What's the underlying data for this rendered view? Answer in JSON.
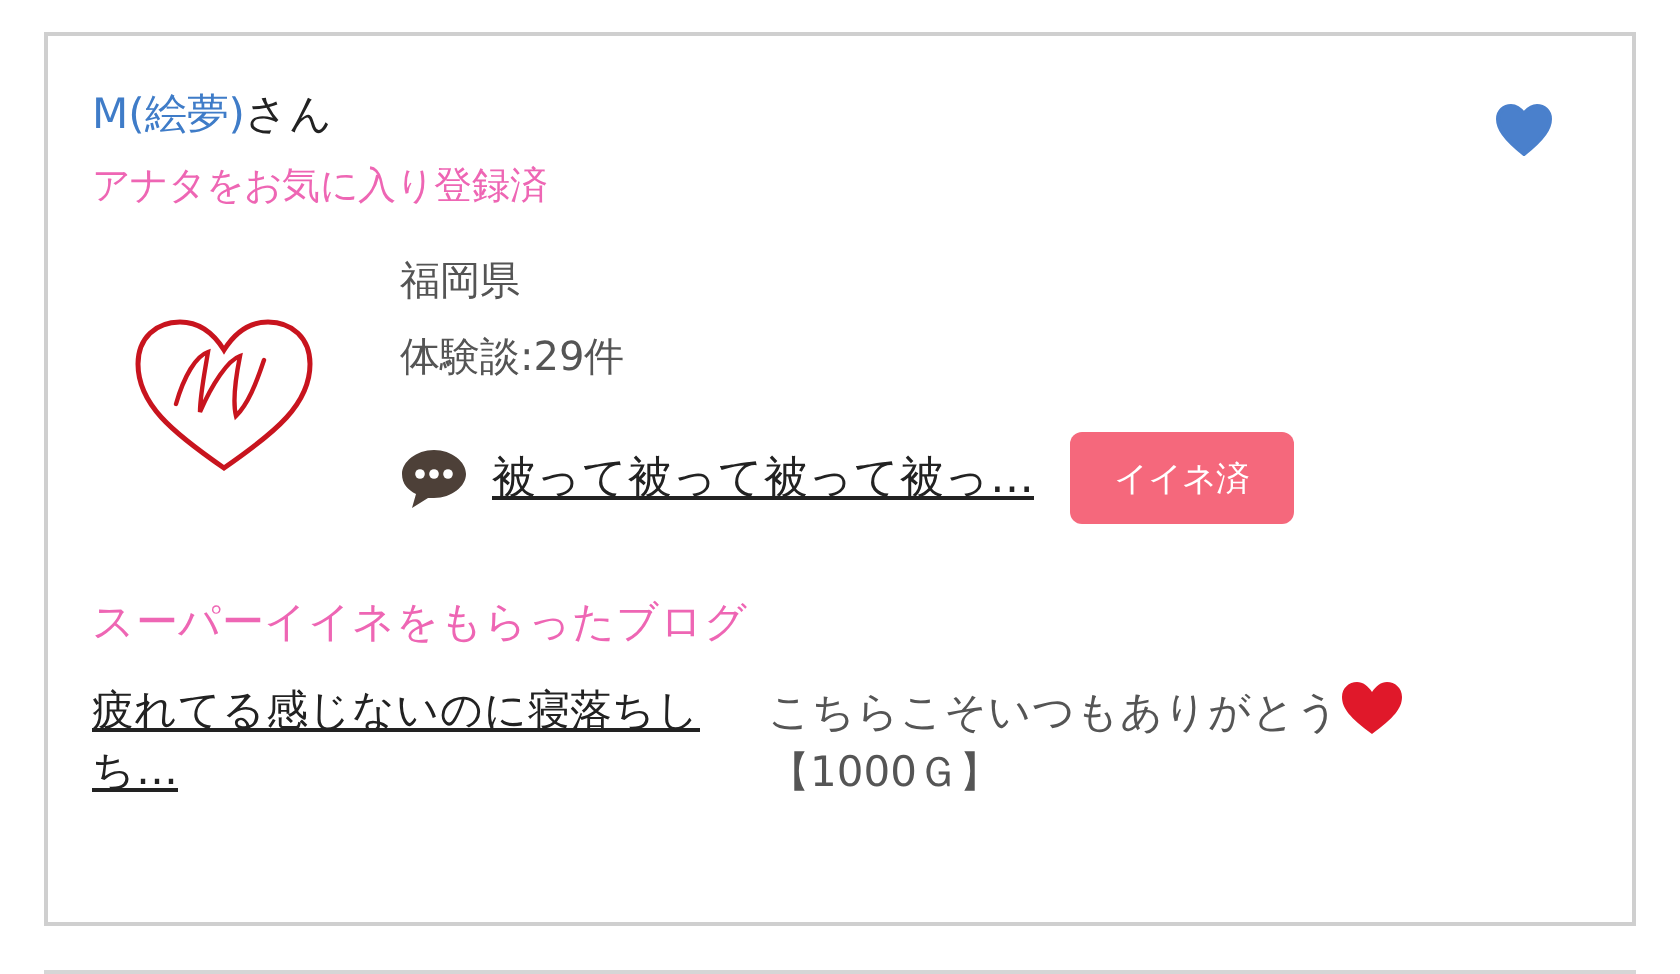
{
  "user": {
    "name": "M(絵夢)",
    "suffix": "さん",
    "favorited": true,
    "note": "アナタをお気に入り登録済"
  },
  "profile": {
    "area": "福岡県",
    "reviews": "体験談:29件",
    "latest_post": "被って被って被って被っ…",
    "like_button": {
      "label": "イイネ済",
      "liked": true
    }
  },
  "super_like_section": {
    "title": "スーパーイイネをもらったブログ",
    "blogs": [
      {
        "title": "疲れてる感じないのに寝落ちしち…",
        "message": "こちらこそいつもありがとう",
        "points": "【1000Ｇ】"
      }
    ]
  }
}
